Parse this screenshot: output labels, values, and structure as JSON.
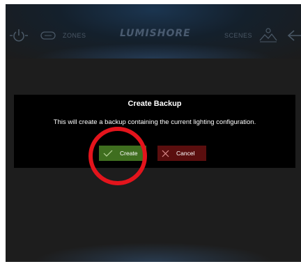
{
  "nav": {
    "zones_label": "ZONES",
    "logo_text": "LUMISHORE",
    "scenes_label": "SCENES",
    "icons": [
      "power-icon",
      "zone-icon",
      "scenes-icon",
      "back-arrow-icon"
    ]
  },
  "dialog": {
    "title": "Create Backup",
    "message": "This will create a backup containing the current lighting configuration.",
    "create_label": "Create",
    "cancel_label": "Cancel"
  },
  "colors": {
    "create_button": "#3f6e1f",
    "cancel_button": "#5a0e0e",
    "annotation": "#e3141c"
  }
}
